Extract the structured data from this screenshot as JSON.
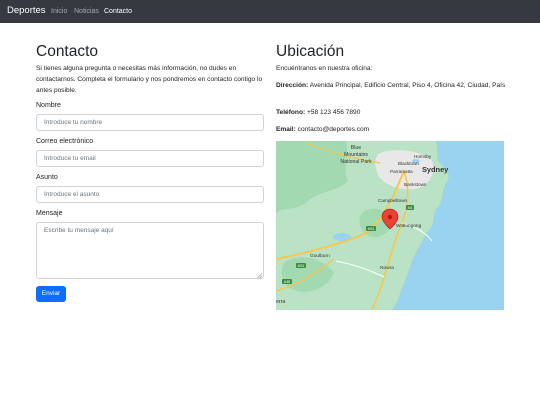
{
  "navbar": {
    "brand": "Deportes",
    "links": [
      {
        "label": "Inicio",
        "active": false
      },
      {
        "label": "Noticias",
        "active": false
      },
      {
        "label": "Contacto",
        "active": true
      }
    ]
  },
  "contact": {
    "title": "Contacto",
    "intro": "Si tienes alguna pregunta o necesitas más información, no dudes en contactarnos. Completa el formulario y nos pondremos en contacto contigo lo antes posible.",
    "fields": {
      "name": {
        "label": "Nombre",
        "placeholder": "Introduce tu nombre",
        "value": ""
      },
      "email": {
        "label": "Correo electrónico",
        "placeholder": "Introduce tu email",
        "value": ""
      },
      "subject": {
        "label": "Asunto",
        "placeholder": "Introduce el asunto",
        "value": ""
      },
      "message": {
        "label": "Mensaje",
        "placeholder": "Escribe tu mensaje aquí",
        "value": ""
      }
    },
    "submit_label": "Enviar"
  },
  "location": {
    "title": "Ubicación",
    "intro": "Encuéntranos en nuestra oficina:",
    "address_label": "Dirección:",
    "address_value": "Avenida Principal, Edificio Central, Piso 4, Oficina 42, Ciudad, País",
    "phone_label": "Teléfono:",
    "phone_value": "+58 123 456 7890",
    "email_label": "Email:",
    "email_value": "contacto@deportes.com"
  },
  "map": {
    "place_labels": {
      "blue_mountains_1": "Blue",
      "blue_mountains_2": "Mountains",
      "blue_mountains_3": "National Park",
      "hornsby": "Hornsby",
      "blacktown": "Blacktown",
      "parramatta": "Parramatta",
      "sydney": "Sydney",
      "bankstown": "Bankstown",
      "campbelltown": "Campbelltown",
      "wollongong": "Wollongong",
      "goulburn": "Goulburn",
      "nowra": "Nowra",
      "berra": "erra"
    },
    "road_labels": [
      "M31",
      "M1",
      "M31",
      "A48"
    ],
    "colors": {
      "land": "#b9e3c4",
      "water": "#9ad3f0",
      "highway": "#f6c64f",
      "pin": "#ea4335"
    }
  }
}
